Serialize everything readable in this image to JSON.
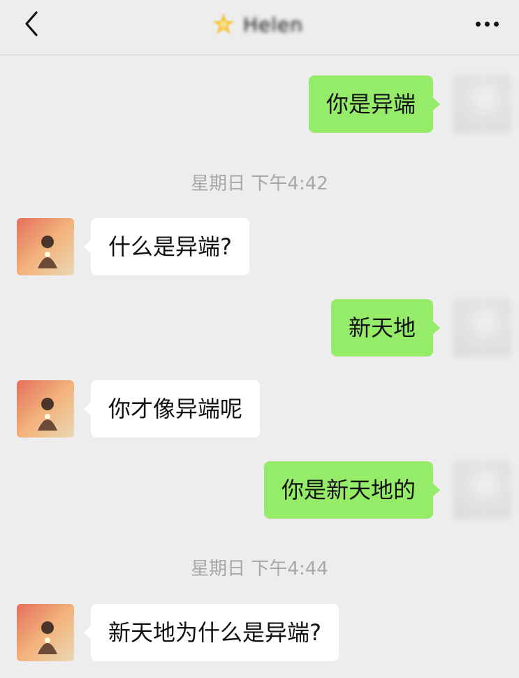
{
  "header": {
    "contact_name": "Helen",
    "back_icon": "chevron-left-icon",
    "more_icon": "more-dots-icon",
    "title_icon": "star-badge-icon"
  },
  "messages": [
    {
      "type": "message",
      "side": "right",
      "text": "你是异端"
    },
    {
      "type": "time",
      "text": "星期日 下午4:42"
    },
    {
      "type": "message",
      "side": "left",
      "text": "什么是异端?"
    },
    {
      "type": "message",
      "side": "right",
      "text": "新天地"
    },
    {
      "type": "message",
      "side": "left",
      "text": "你才像异端呢"
    },
    {
      "type": "message",
      "side": "right",
      "text": "你是新天地的"
    },
    {
      "type": "time",
      "text": "星期日 下午4:44"
    },
    {
      "type": "message",
      "side": "left",
      "text": "新天地为什么是异端?"
    }
  ],
  "colors": {
    "background": "#ededed",
    "outgoing_bubble": "#95ec69",
    "incoming_bubble": "#ffffff",
    "timestamp_text": "#a8a8a8"
  }
}
